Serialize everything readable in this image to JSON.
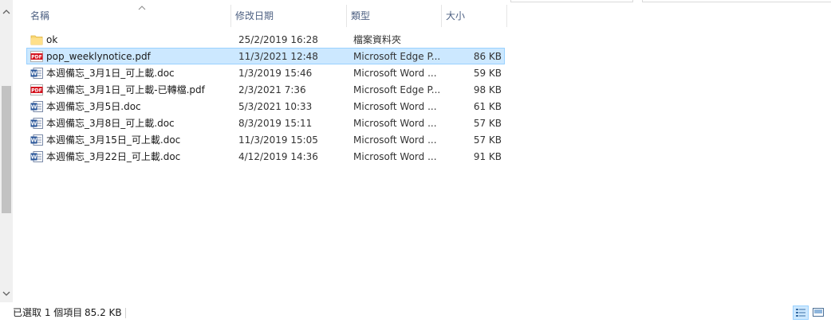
{
  "columns": {
    "name": "名稱",
    "date": "修改日期",
    "type": "類型",
    "size": "大小"
  },
  "files": [
    {
      "icon": "folder-icon",
      "name": "ok",
      "date": "25/2/2019 16:28",
      "type": "檔案資料夾",
      "size": ""
    },
    {
      "icon": "pdf-icon",
      "name": "pop_weeklynotice.pdf",
      "date": "11/3/2021 12:48",
      "type": "Microsoft Edge P...",
      "size": "86 KB",
      "selected": true
    },
    {
      "icon": "word-doc-icon",
      "name": "本週備忘_3月1日_可上載.doc",
      "date": "1/3/2019 15:46",
      "type": "Microsoft Word ...",
      "size": "59 KB"
    },
    {
      "icon": "pdf-icon",
      "name": "本週備忘_3月1日_可上載-已轉檔.pdf",
      "date": "2/3/2021 7:36",
      "type": "Microsoft Edge P...",
      "size": "98 KB"
    },
    {
      "icon": "word-doc-icon",
      "name": "本週備忘_3月5日.doc",
      "date": "5/3/2021 10:33",
      "type": "Microsoft Word ...",
      "size": "61 KB"
    },
    {
      "icon": "word-doc-icon",
      "name": "本週備忘_3月8日_可上載.doc",
      "date": "8/3/2019 15:11",
      "type": "Microsoft Word ...",
      "size": "57 KB"
    },
    {
      "icon": "word-doc-icon",
      "name": "本週備忘_3月15日_可上載.doc",
      "date": "11/3/2019 15:05",
      "type": "Microsoft Word ...",
      "size": "57 KB"
    },
    {
      "icon": "word-doc-icon",
      "name": "本週備忘_3月22日_可上載.doc",
      "date": "4/12/2019 14:36",
      "type": "Microsoft Word ...",
      "size": "91 KB"
    }
  ],
  "status": {
    "selection": "已選取 1 個項目",
    "size": "85.2 KB"
  },
  "icons": {
    "sort": "sort-up-icon",
    "scroll_up": "scroll-up-icon",
    "scroll_down": "scroll-down-icon",
    "details_view": "details-view-icon",
    "large_icons_view": "large-icons-view-icon"
  },
  "colors": {
    "selection_bg": "#cce8ff",
    "selection_border": "#99d1ff",
    "header_text": "#4d6082",
    "pdf_red": "#d4121e",
    "word_blue": "#2b579a",
    "folder_yellow": "#f8d775"
  }
}
